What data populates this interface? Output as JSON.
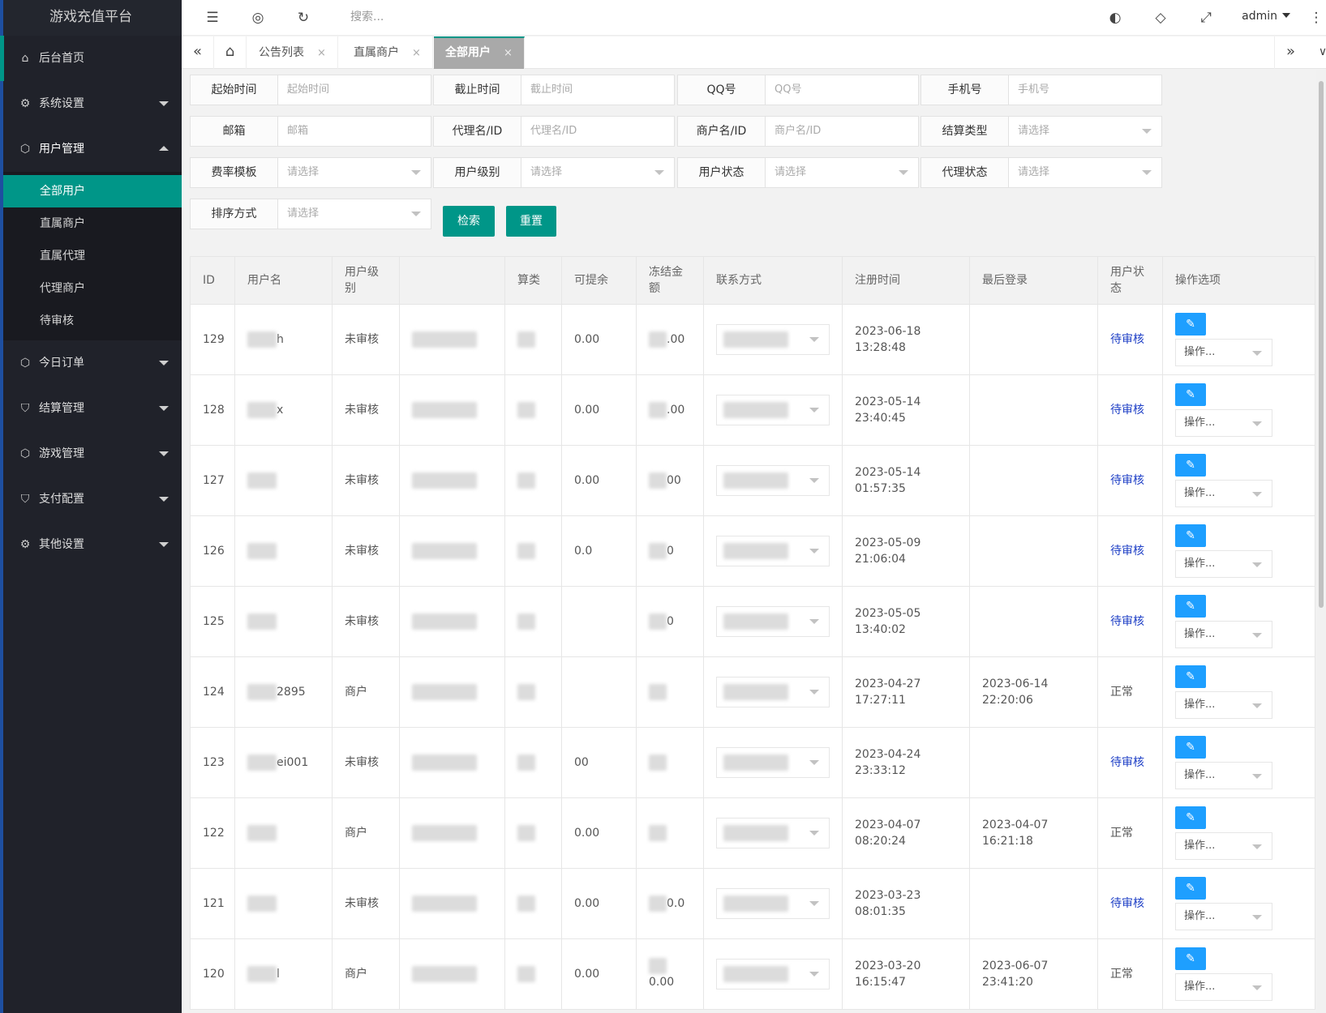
{
  "app": {
    "title": "游戏充值平台"
  },
  "sidebar": {
    "items": [
      {
        "label": "后台首页",
        "icon": "home-icon"
      },
      {
        "label": "系统设置",
        "icon": "gear-icon"
      },
      {
        "label": "用户管理",
        "icon": "cube-icon",
        "expanded": true,
        "children": [
          "全部用户",
          "直属商户",
          "直属代理",
          "代理商户",
          "待审核"
        ],
        "current": "全部用户"
      },
      {
        "label": "今日订单",
        "icon": "cube-icon"
      },
      {
        "label": "结算管理",
        "icon": "shield-icon"
      },
      {
        "label": "游戏管理",
        "icon": "cube-icon"
      },
      {
        "label": "支付配置",
        "icon": "shield-icon"
      },
      {
        "label": "其他设置",
        "icon": "gear-icon"
      }
    ]
  },
  "header": {
    "search_placeholder": "搜索...",
    "user": "admin"
  },
  "tabs": [
    {
      "label": "公告列表",
      "close": "×"
    },
    {
      "label": "直属商户",
      "close": "×"
    },
    {
      "label": "全部用户",
      "close": "×",
      "active": true
    }
  ],
  "filters": [
    {
      "label": "起始时间",
      "placeholder": "起始时间",
      "select": false
    },
    {
      "label": "截止时间",
      "placeholder": "截止时间",
      "select": false
    },
    {
      "label": "QQ号",
      "placeholder": "QQ号",
      "select": false
    },
    {
      "label": "手机号",
      "placeholder": "手机号",
      "select": false
    },
    {
      "label": "邮箱",
      "placeholder": "邮箱",
      "select": false
    },
    {
      "label": "代理名/ID",
      "placeholder": "代理名/ID",
      "select": false
    },
    {
      "label": "商户名/ID",
      "placeholder": "商户名/ID",
      "select": false
    },
    {
      "label": "结算类型",
      "placeholder": "请选择",
      "select": true
    },
    {
      "label": "费率模板",
      "placeholder": "请选择",
      "select": true
    },
    {
      "label": "用户级别",
      "placeholder": "请选择",
      "select": true
    },
    {
      "label": "用户状态",
      "placeholder": "请选择",
      "select": true
    },
    {
      "label": "代理状态",
      "placeholder": "请选择",
      "select": true
    },
    {
      "label": "排序方式",
      "placeholder": "请选择",
      "select": true
    }
  ],
  "buttons": {
    "search": "检索",
    "reset": "重置"
  },
  "table": {
    "columns": [
      "ID",
      "用户名",
      "用户级别",
      "",
      "算类",
      "可提余",
      "冻结金额",
      "联系方式",
      "注册时间",
      "最后登录",
      "用户状态",
      "操作选项"
    ],
    "op_label": "操作...",
    "edit_icon": "✎",
    "rows": [
      {
        "id": "129",
        "name": "h",
        "level": "未审核",
        "withdraw": "0.00",
        "frozen": ".00",
        "reg": "2023-06-18 13:28:48",
        "last": "",
        "status": "待审核",
        "pending": true
      },
      {
        "id": "128",
        "name": "x",
        "level": "未审核",
        "withdraw": "0.00",
        "frozen": ".00",
        "reg": "2023-05-14 23:40:45",
        "last": "",
        "status": "待审核",
        "pending": true
      },
      {
        "id": "127",
        "name": "",
        "level": "未审核",
        "withdraw": "0.00",
        "frozen": "00",
        "reg": "2023-05-14 01:57:35",
        "last": "",
        "status": "待审核",
        "pending": true
      },
      {
        "id": "126",
        "name": "",
        "level": "未审核",
        "withdraw": "0.0",
        "frozen": "0",
        "reg": "2023-05-09 21:06:04",
        "last": "",
        "status": "待审核",
        "pending": true
      },
      {
        "id": "125",
        "name": "",
        "level": "未审核",
        "withdraw": "",
        "frozen": "0",
        "reg": "2023-05-05 13:40:02",
        "last": "",
        "status": "待审核",
        "pending": true
      },
      {
        "id": "124",
        "name": "2895",
        "level": "商户",
        "withdraw": "",
        "frozen": "",
        "reg": "2023-04-27 17:27:11",
        "last": "2023-06-14 22:20:06",
        "status": "正常",
        "pending": false
      },
      {
        "id": "123",
        "name": "ei001",
        "level": "未审核",
        "withdraw": "00",
        "frozen": "",
        "reg": "2023-04-24 23:33:12",
        "last": "",
        "status": "待审核",
        "pending": true
      },
      {
        "id": "122",
        "name": "",
        "level": "商户",
        "withdraw": "0.00",
        "frozen": "",
        "reg": "2023-04-07 08:20:24",
        "last": "2023-04-07 16:21:18",
        "status": "正常",
        "pending": false
      },
      {
        "id": "121",
        "name": "",
        "level": "未审核",
        "withdraw": "0.00",
        "frozen": "0.0",
        "reg": "2023-03-23 08:01:35",
        "last": "",
        "status": "待审核",
        "pending": true
      },
      {
        "id": "120",
        "name": "l",
        "level": "商户",
        "withdraw": "0.00",
        "frozen": "0.00",
        "reg": "2023-03-20 16:15:47",
        "last": "2023-06-07 23:41:20",
        "status": "正常",
        "pending": false
      }
    ]
  },
  "colors": {
    "accent": "#009688",
    "sidebar_bg": "#20222a",
    "edit_button": "#1e9fff",
    "pending_link": "#1e3fc6"
  }
}
